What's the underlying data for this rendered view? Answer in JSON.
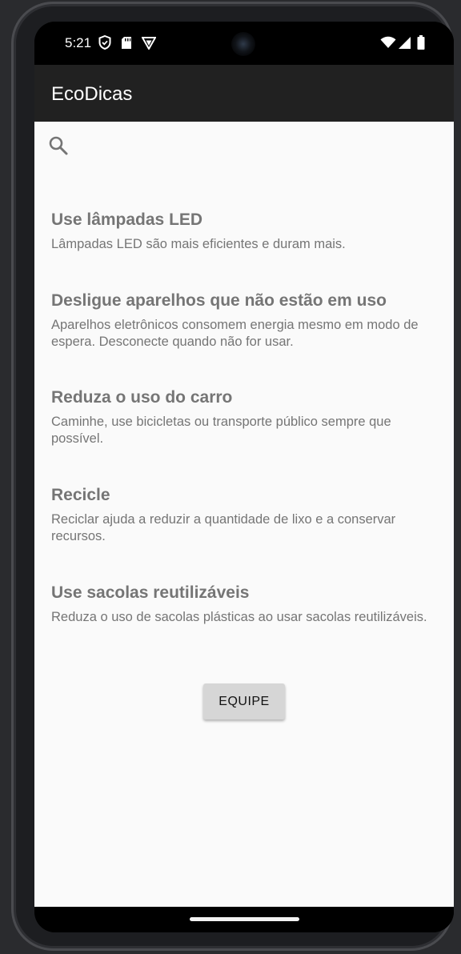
{
  "status_bar": {
    "time": "5:21",
    "left_icons": [
      "shield-icon",
      "sd-card-icon",
      "vpn-icon"
    ],
    "right_icons": [
      "wifi-icon",
      "cell-signal-icon",
      "battery-icon"
    ]
  },
  "app_bar": {
    "title": "EcoDicas"
  },
  "search": {
    "icon": "search-icon"
  },
  "tips": [
    {
      "title": "Use lâmpadas LED",
      "description": "Lâmpadas LED são mais eficientes e duram mais."
    },
    {
      "title": "Desligue aparelhos que não estão em uso",
      "description": "Aparelhos eletrônicos consomem energia mesmo em modo de espera. Desconecte quando não for usar."
    },
    {
      "title": "Reduza o uso do carro",
      "description": "Caminhe, use bicicletas ou transporte público sempre que possível."
    },
    {
      "title": "Recicle",
      "description": "Reciclar ajuda a reduzir a quantidade de lixo e a conservar recursos."
    },
    {
      "title": "Use sacolas reutilizáveis",
      "description": "Reduza o uso de sacolas plásticas ao usar sacolas reutilizáveis."
    }
  ],
  "buttons": {
    "equipe_label": "EQUIPE"
  },
  "colors": {
    "app_bar": "#212121",
    "content_bg": "#fafafa",
    "text_gray": "#757575",
    "button_bg": "#d6d6d6"
  }
}
